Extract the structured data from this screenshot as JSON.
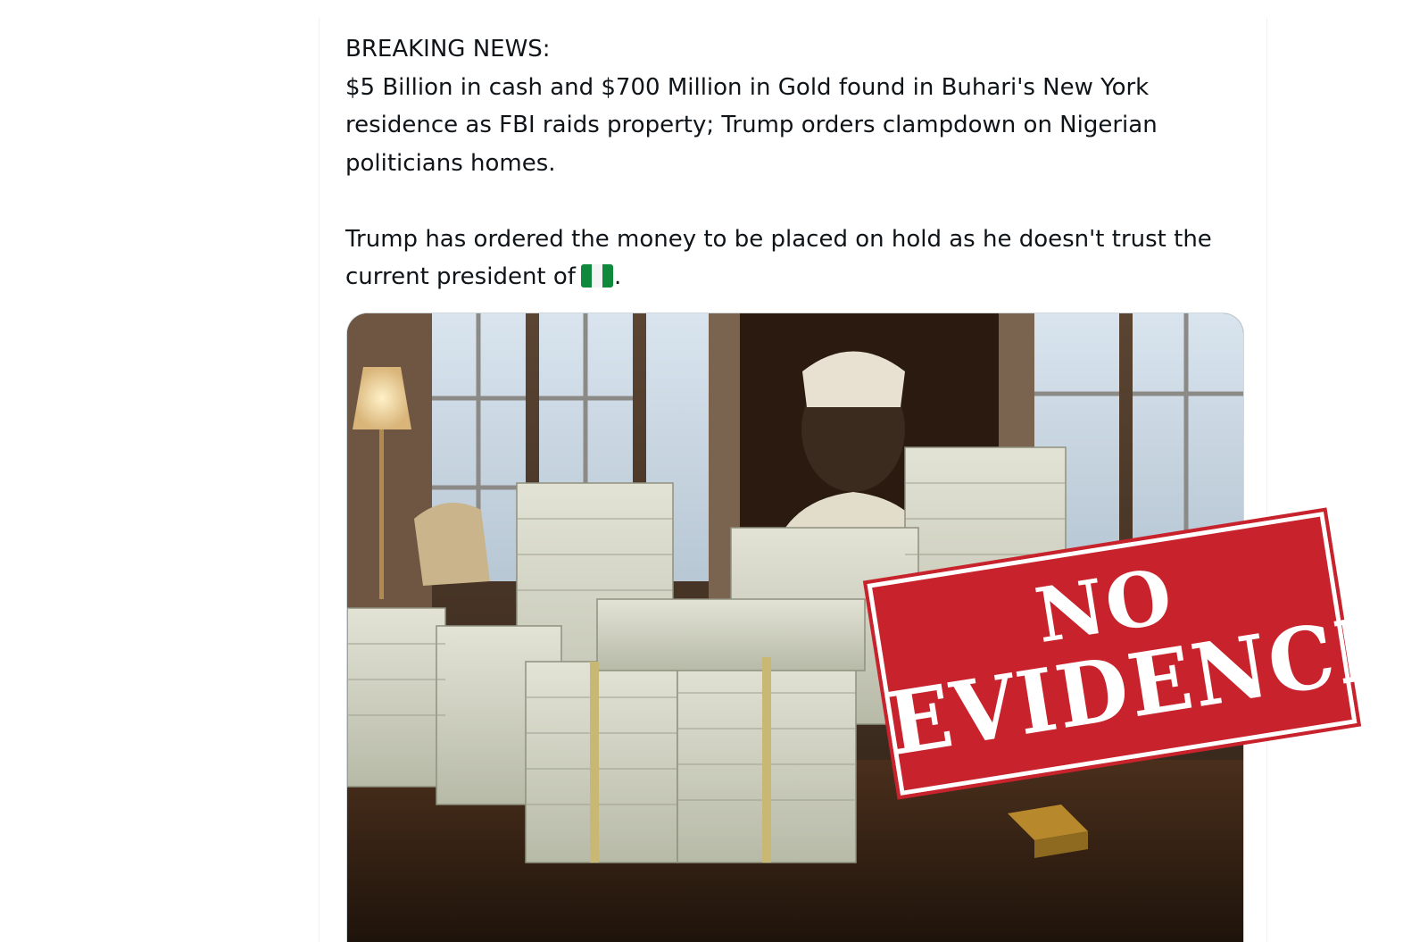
{
  "post": {
    "paragraphs": [
      "BREAKING NEWS:",
      "$5 Billion in cash and $700 Million in Gold found in Buhari's New York residence as FBI raids property; Trump orders clampdown on Nigerian politicians homes.",
      "Trump has ordered the money to be placed on hold as he doesn't trust the current president of",
      "."
    ],
    "flag_icon": "nigeria-flag-emoji"
  },
  "stamp": {
    "line1": "NO",
    "line2": "EVIDENCE",
    "color": "#c8232c"
  },
  "colors": {
    "text": "#0f1419",
    "border": "#eff3f4"
  }
}
